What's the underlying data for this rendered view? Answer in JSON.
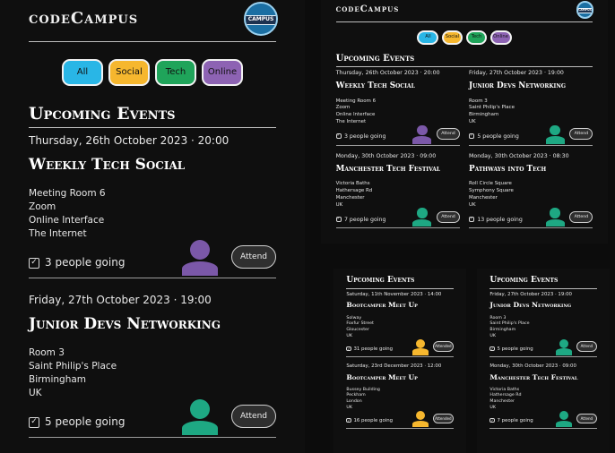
{
  "app": {
    "brand": "codeCampus",
    "logo_text": "CAMPUS"
  },
  "filters": [
    {
      "label": "All",
      "color": "#29b6e6"
    },
    {
      "label": "Social",
      "color": "#f6b72e"
    },
    {
      "label": "Tech",
      "color": "#1fa45a"
    },
    {
      "label": "Online",
      "color": "#8d63b3"
    }
  ],
  "colors": {
    "purple": "#7b58a8",
    "teal": "#1ea883",
    "yellow": "#f6b72e"
  },
  "panel_main": {
    "heading": "Upcoming Events",
    "events": [
      {
        "date": "Thursday, 26th October 2023 · 20:00",
        "title": "Weekly Tech Social",
        "address": [
          "Meeting Room 6",
          "Zoom",
          "Online Interface",
          "The Internet"
        ],
        "going": "3 people going",
        "button": "Attend",
        "avatar": "purple"
      },
      {
        "date": "Friday, 27th October 2023 · 19:00",
        "title": "Junior Devs Networking",
        "address": [
          "Room 3",
          "Saint Philip's Place",
          "Birmingham",
          "UK"
        ],
        "going": "5 people going",
        "button": "Attend",
        "avatar": "teal"
      }
    ]
  },
  "panel_grid": {
    "heading": "Upcoming Events",
    "events": [
      {
        "date": "Thursday, 26th October 2023 · 20:00",
        "title": "Weekly Tech Social",
        "address": [
          "Meeting Room 6",
          "Zoom",
          "Online Interface",
          "The Internet"
        ],
        "going": "3 people going",
        "button": "Attend",
        "avatar": "purple"
      },
      {
        "date": "Friday, 27th October 2023 · 19:00",
        "title": "Junior Devs Networking",
        "address": [
          "Room 3",
          "Saint Philip's Place",
          "Birmingham",
          "UK"
        ],
        "going": "5 people going",
        "button": "Attend",
        "avatar": "teal"
      },
      {
        "date": "Monday, 30th October 2023 · 09:00",
        "title": "Manchester Tech Festival",
        "address": [
          "Victoria Baths",
          "Hathersage Rd",
          "Manchester",
          "UK"
        ],
        "going": "7 people going",
        "button": "Attend",
        "avatar": "teal"
      },
      {
        "date": "Monday, 30th October 2023 · 08:30",
        "title": "Pathways into Tech",
        "address": [
          "Roll Circle Square",
          "Symphony Square",
          "Manchester",
          "UK"
        ],
        "going": "13 people going",
        "button": "Attend",
        "avatar": "teal"
      }
    ]
  },
  "panel_left_bottom": {
    "heading": "Upcoming Events",
    "events": [
      {
        "date": "Saturday, 11th November 2023 · 14:00",
        "title": "Bootcamper Meet Up",
        "address": [
          "Solway",
          "Foxfur Street",
          "Gloucester",
          "UK"
        ],
        "going": "31 people going",
        "button": "Attended",
        "avatar": "yellow"
      },
      {
        "date": "Saturday, 23rd December 2023 · 12:00",
        "title": "Bootcamper Meet Up",
        "address": [
          "Bussey Building",
          "Peckham",
          "London",
          "UK"
        ],
        "going": "16 people going",
        "button": "Attended",
        "avatar": "yellow"
      }
    ]
  },
  "panel_right_bottom": {
    "heading": "Upcoming Events",
    "events": [
      {
        "date": "Friday, 27th October 2023 · 19:00",
        "title": "Junior Devs Networking",
        "address": [
          "Room 3",
          "Saint Philip's Place",
          "Birmingham",
          "UK"
        ],
        "going": "5 people going",
        "button": "Attend",
        "avatar": "teal"
      },
      {
        "date": "Monday, 30th October 2023 · 09:00",
        "title": "Manchester Tech Festival",
        "address": [
          "Victoria Baths",
          "Hathersage Rd",
          "Manchester",
          "UK"
        ],
        "going": "7 people going",
        "button": "Attend",
        "avatar": "teal"
      }
    ]
  }
}
